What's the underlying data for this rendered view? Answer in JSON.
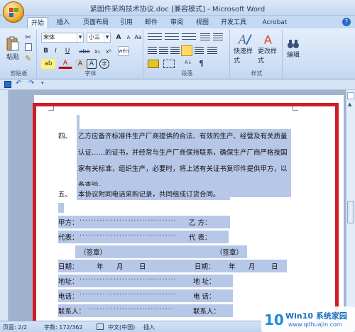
{
  "window": {
    "title": "紧固件采购技术协议.doc [兼容模式] - Microsoft Word"
  },
  "tabs": [
    {
      "label": "开始",
      "active": true
    },
    {
      "label": "插入"
    },
    {
      "label": "页面布局"
    },
    {
      "label": "引用"
    },
    {
      "label": "邮件"
    },
    {
      "label": "审阅"
    },
    {
      "label": "视图"
    },
    {
      "label": "开发工具"
    },
    {
      "label": "Acrobat"
    }
  ],
  "ribbon": {
    "clipboard": {
      "paste_label": "粘贴",
      "group_label": "剪贴板"
    },
    "font": {
      "font_name": "宋体",
      "font_size": "小三",
      "group_label": "字体",
      "bold": "B",
      "italic": "I",
      "underline": "U",
      "strike": "abe",
      "sub": "x₂",
      "sup": "x²",
      "clear": "Aa",
      "grow": "A",
      "shrink": "A",
      "color_a": "A",
      "char_a": "A",
      "border_a": "A",
      "phonetic": "wén",
      "enclose": "字"
    },
    "paragraph": {
      "group_label": "段落"
    },
    "styles": {
      "quick_label": "快速样式",
      "change_label": "更改样式",
      "group_label": "样式"
    },
    "editing": {
      "label": "编辑"
    }
  },
  "document": {
    "item4_num": "四、",
    "item4_lines": [
      "乙方应备齐标准件生产厂商提供的合法、有效的生产、经营及有关质量",
      "认证……的证书，并经常与生产厂商保持联系，确保生产厂商严格按国",
      "家有关标准，组织生产，必要时，将上述有关证书复印件提供甲方，以",
      "备查验。"
    ],
    "item5_num": "五、",
    "item5_line": "本协议附同电话采购记录，共同组成订货合同。",
    "sign": {
      "party_a": "甲方：",
      "party_b": "乙   方：",
      "rep_a": "代表：",
      "rep_b": "代   表：",
      "seal_a": "（签章）",
      "seal_b": "（签章）",
      "date_a": "日期：",
      "date_b": "日期：",
      "year": "年",
      "month": "月",
      "day": "日",
      "addr_a": "地址：",
      "addr_b": "地   址：",
      "tel_a": "电话：",
      "tel_b": "电   话：",
      "contact_a": "联系人：",
      "contact_b": "联系人："
    }
  },
  "statusbar": {
    "page": "页面: 2/2",
    "words": "字数: 172/362",
    "lang": "中文(中国)",
    "mode": "插入"
  },
  "watermark": {
    "brand": "Win10 系统家园",
    "url": "www.qdhuajin.com"
  },
  "colors": {
    "highlight": "#b6c7e8",
    "frame": "#d01c24",
    "ribbon": "#cfe0f5"
  }
}
